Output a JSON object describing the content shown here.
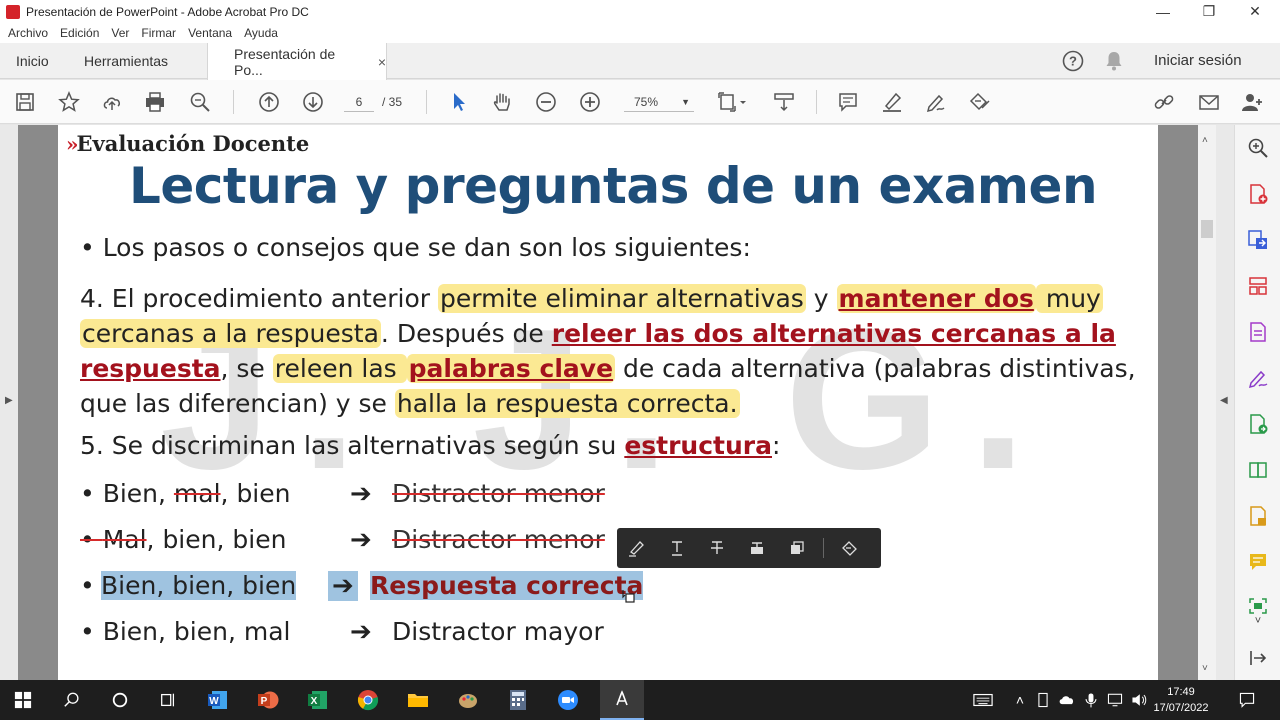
{
  "window": {
    "title": "Presentación de PowerPoint - Adobe Acrobat Pro DC"
  },
  "menu": [
    "Archivo",
    "Edición",
    "Ver",
    "Firmar",
    "Ventana",
    "Ayuda"
  ],
  "tabs": {
    "home": "Inicio",
    "tools": "Herramientas",
    "doc": "Presentación de Po...",
    "close": "×"
  },
  "account": {
    "signin": "Iniciar sesión"
  },
  "toolbar": {
    "page_current": "6",
    "page_total": "/ 35",
    "zoom": "75%"
  },
  "slide": {
    "brand": "Evaluación Docente",
    "brand_chevron": "»",
    "title": "Lectura y preguntas de un examen",
    "bullet1": "• Los pasos o consejos que se dan son los siguientes:",
    "p4": {
      "a": "4. El procedimiento anterior ",
      "b": "permite eliminar alternativas",
      "c": " y ",
      "d": "mantener dos",
      "e": " muy",
      "f": "cercanas a la respuesta",
      "g": ". Después de ",
      "h": "releer las dos alternativas cercanas a la",
      "i": "respuesta",
      "j": ", se ",
      "k": "releen las ",
      "l": "palabras clave",
      "m": " de cada alternativa (palabras distintivas,",
      "n": "que las diferencian) y se ",
      "o": "halla la respuesta correcta."
    },
    "p5": {
      "a": "5. Se discriminan las alternativas según su ",
      "b": "estructura",
      "c": ":"
    },
    "rows": [
      {
        "pre": "• Bien, ",
        "strike": "mal",
        "post": ", bien",
        "arrow": "➔",
        "result": "Distractor menor"
      },
      {
        "pre": "• ",
        "strike": "Mal",
        "post": ", bien, bien",
        "arrow": "➔",
        "result": "Distractor menor"
      },
      {
        "text": "Bien, bien, bien",
        "arrow": "➔",
        "result": "Respuesta correcta"
      },
      {
        "text": "• Bien, bien, mal",
        "arrow": "➔",
        "result": "Distractor mayor"
      }
    ],
    "watermark": "J. J. G."
  },
  "taskbar": {
    "time": "17:49",
    "date": "17/07/2022"
  }
}
